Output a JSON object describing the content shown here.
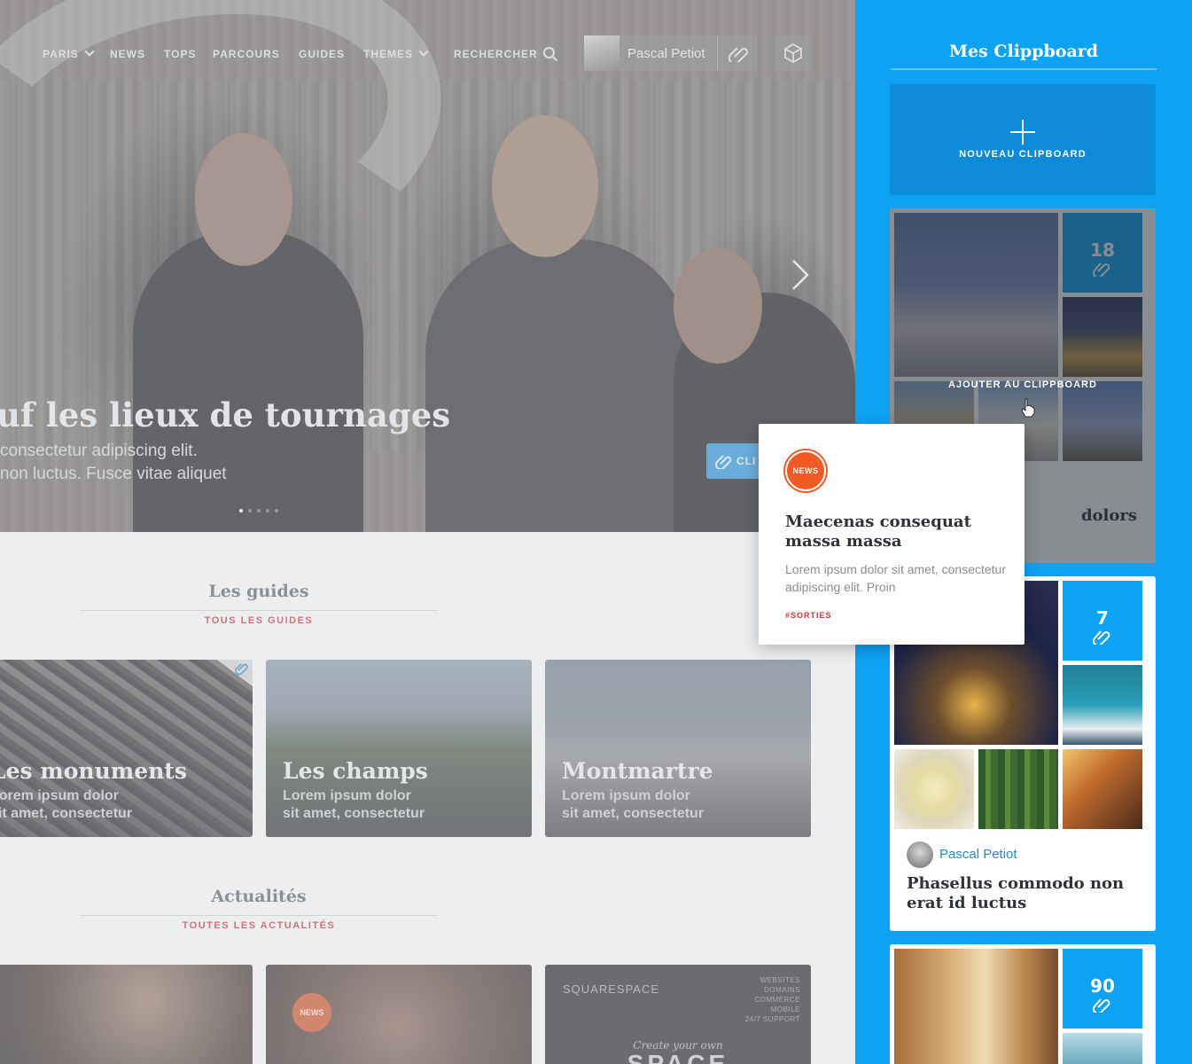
{
  "nav": {
    "items": [
      {
        "label": "PARIS",
        "dropdown": true
      },
      {
        "label": "NEWS",
        "dropdown": false
      },
      {
        "label": "TOPS",
        "dropdown": false
      },
      {
        "label": "PARCOURS",
        "dropdown": false
      },
      {
        "label": "GUIDES",
        "dropdown": false
      },
      {
        "label": "THEMES",
        "dropdown": true
      }
    ],
    "search_label": "RECHERCHER",
    "user_name": "Pascal Petiot"
  },
  "hero": {
    "title": "uf les lieux de tournages",
    "subtitle_line1": "consectetur adipiscing elit.",
    "subtitle_line2": "non luctus. Fusce vitae aliquet",
    "clip_label": "CLI",
    "slide_count": 5,
    "active_slide": 1
  },
  "guides": {
    "title": "Les guides",
    "link": "TOUS LES GUIDES",
    "cards": [
      {
        "title": "Les monuments",
        "line1": "Lorem ipsum dolor",
        "line2": "sit amet, consectetur"
      },
      {
        "title": "Les champs",
        "line1": "Lorem ipsum dolor",
        "line2": "sit amet, consectetur"
      },
      {
        "title": "Montmartre",
        "line1": "Lorem ipsum dolor",
        "line2": "sit amet, consectetur"
      }
    ]
  },
  "news": {
    "title": "Actualités",
    "link": "TOUTES LES ACTUALITÉS",
    "badge": "NEWS",
    "ad": {
      "brand": "SQUARESPACE",
      "services": [
        "WEBSITES",
        "DOMAINS",
        "COMMERCE",
        "MOBILE",
        "24/7 SUPPORT"
      ],
      "tagline": "Create your own",
      "headline": "SPACE"
    }
  },
  "sidebar": {
    "title": "Mes Clippboard",
    "new_label": "NOUVEAU CLIPBOARD",
    "add_label": "AJOUTER AU CLIPPBOARD",
    "clipboards": [
      {
        "count": "18",
        "title_fragment": "dolors"
      },
      {
        "count": "7",
        "author": "Pascal Petiot",
        "title": "Phasellus commodo non erat id luctus"
      },
      {
        "count": "90"
      }
    ]
  },
  "popover": {
    "badge": "NEWS",
    "title": "Maecenas consequat massa massa",
    "text": "Lorem ipsum dolor sit amet, consectetur adipiscing elit. Proin",
    "tag": "#SORTIES"
  },
  "colors": {
    "sidebar_bg": "#0da2f2",
    "new_clipboard_bg": "#0d8ad8",
    "section_link": "#c0393b",
    "news_badge": "#f15a24",
    "author_link": "#1a8fd8"
  }
}
